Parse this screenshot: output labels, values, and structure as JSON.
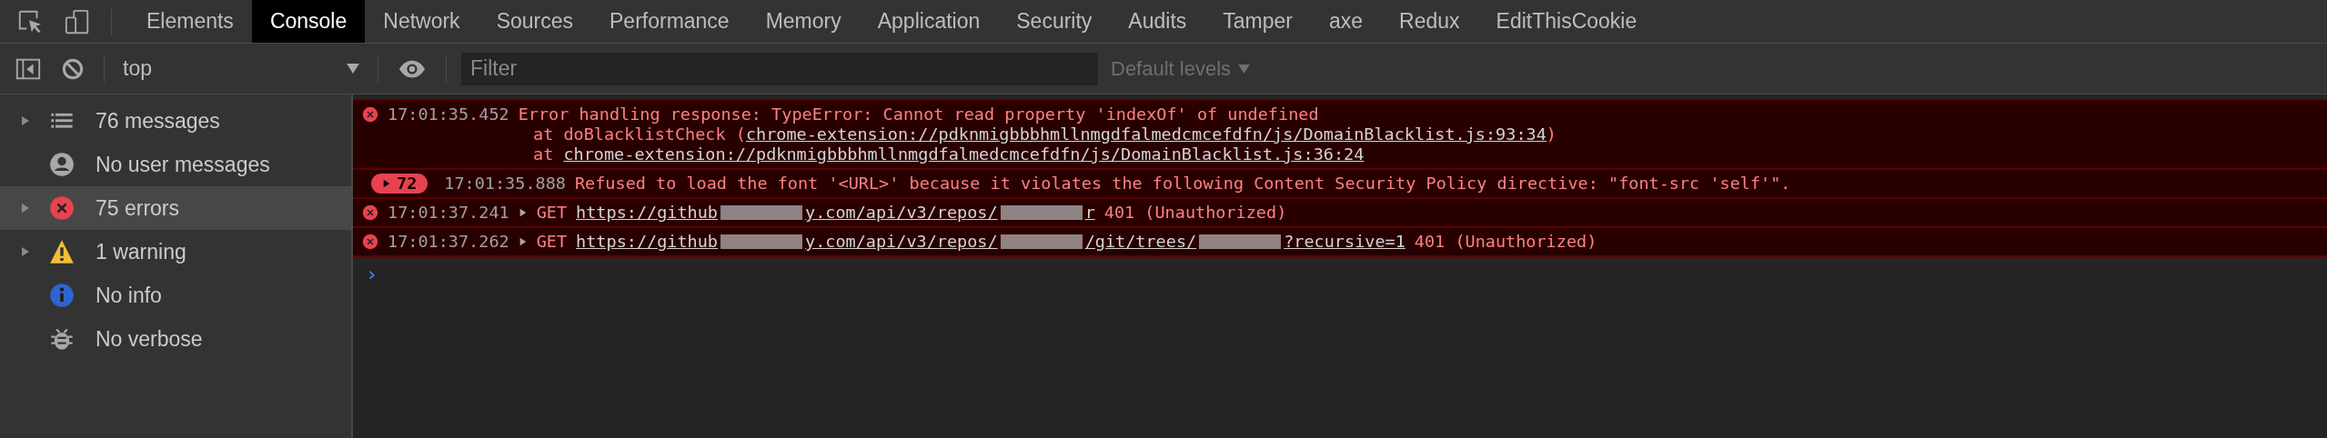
{
  "tabs": [
    {
      "label": "Elements",
      "selected": false
    },
    {
      "label": "Console",
      "selected": true
    },
    {
      "label": "Network",
      "selected": false
    },
    {
      "label": "Sources",
      "selected": false
    },
    {
      "label": "Performance",
      "selected": false
    },
    {
      "label": "Memory",
      "selected": false
    },
    {
      "label": "Application",
      "selected": false
    },
    {
      "label": "Security",
      "selected": false
    },
    {
      "label": "Audits",
      "selected": false
    },
    {
      "label": "Tamper",
      "selected": false
    },
    {
      "label": "axe",
      "selected": false
    },
    {
      "label": "Redux",
      "selected": false
    },
    {
      "label": "EditThisCookie",
      "selected": false
    }
  ],
  "toolbar": {
    "context": "top",
    "filter": {
      "placeholder": "Filter"
    },
    "levels": "Default levels"
  },
  "sidebar": {
    "items": [
      {
        "kind": "list",
        "label": "76 messages",
        "expandable": true,
        "selected": false
      },
      {
        "kind": "user",
        "label": "No user messages",
        "expandable": false,
        "selected": false
      },
      {
        "kind": "error",
        "label": "75 errors",
        "expandable": true,
        "selected": true
      },
      {
        "kind": "warning",
        "label": "1 warning",
        "expandable": true,
        "selected": false
      },
      {
        "kind": "info",
        "label": "No info",
        "expandable": false,
        "selected": false
      },
      {
        "kind": "verbose",
        "label": "No verbose",
        "expandable": false,
        "selected": false
      }
    ]
  },
  "messages": [
    {
      "kind": "error",
      "time": "17:01:35.452",
      "text": "Error handling response: TypeError: Cannot read property 'indexOf' of undefined",
      "stack": [
        {
          "prefix": "at doBlacklistCheck (",
          "link": "chrome-extension://pdknmigbbbhmllnmgdfalmedcmcefdfn/js/DomainBlacklist.js:93:34",
          "suffix": ")"
        },
        {
          "prefix": "at ",
          "link": "chrome-extension://pdknmigbbbhmllnmgdfalmedcmcefdfn/js/DomainBlacklist.js:36:24"
        }
      ]
    },
    {
      "kind": "repeat",
      "count": "72",
      "time": "17:01:35.888",
      "text": "Refused to load the font '<URL>' because it violates the following Content Security Policy directive: \"font-src 'self'\"."
    },
    {
      "kind": "network",
      "time": "17:01:37.241",
      "method": "GET",
      "url": [
        {
          "kind": "text",
          "text": "https://github"
        },
        {
          "kind": "redacted"
        },
        {
          "kind": "text",
          "text": "y.com/api/v3/repos/"
        },
        {
          "kind": "redacted"
        },
        {
          "kind": "text",
          "text": "r"
        }
      ],
      "status": "401 (Unauthorized)"
    },
    {
      "kind": "network",
      "time": "17:01:37.262",
      "method": "GET",
      "url": [
        {
          "kind": "text",
          "text": "https://github"
        },
        {
          "kind": "redacted"
        },
        {
          "kind": "text",
          "text": "y.com/api/v3/repos/"
        },
        {
          "kind": "redacted"
        },
        {
          "kind": "text",
          "text": "/git/trees/"
        },
        {
          "kind": "redacted"
        },
        {
          "kind": "text",
          "text": "?recursive=1"
        }
      ],
      "status": "401 (Unauthorized)"
    }
  ],
  "prompt": "›"
}
